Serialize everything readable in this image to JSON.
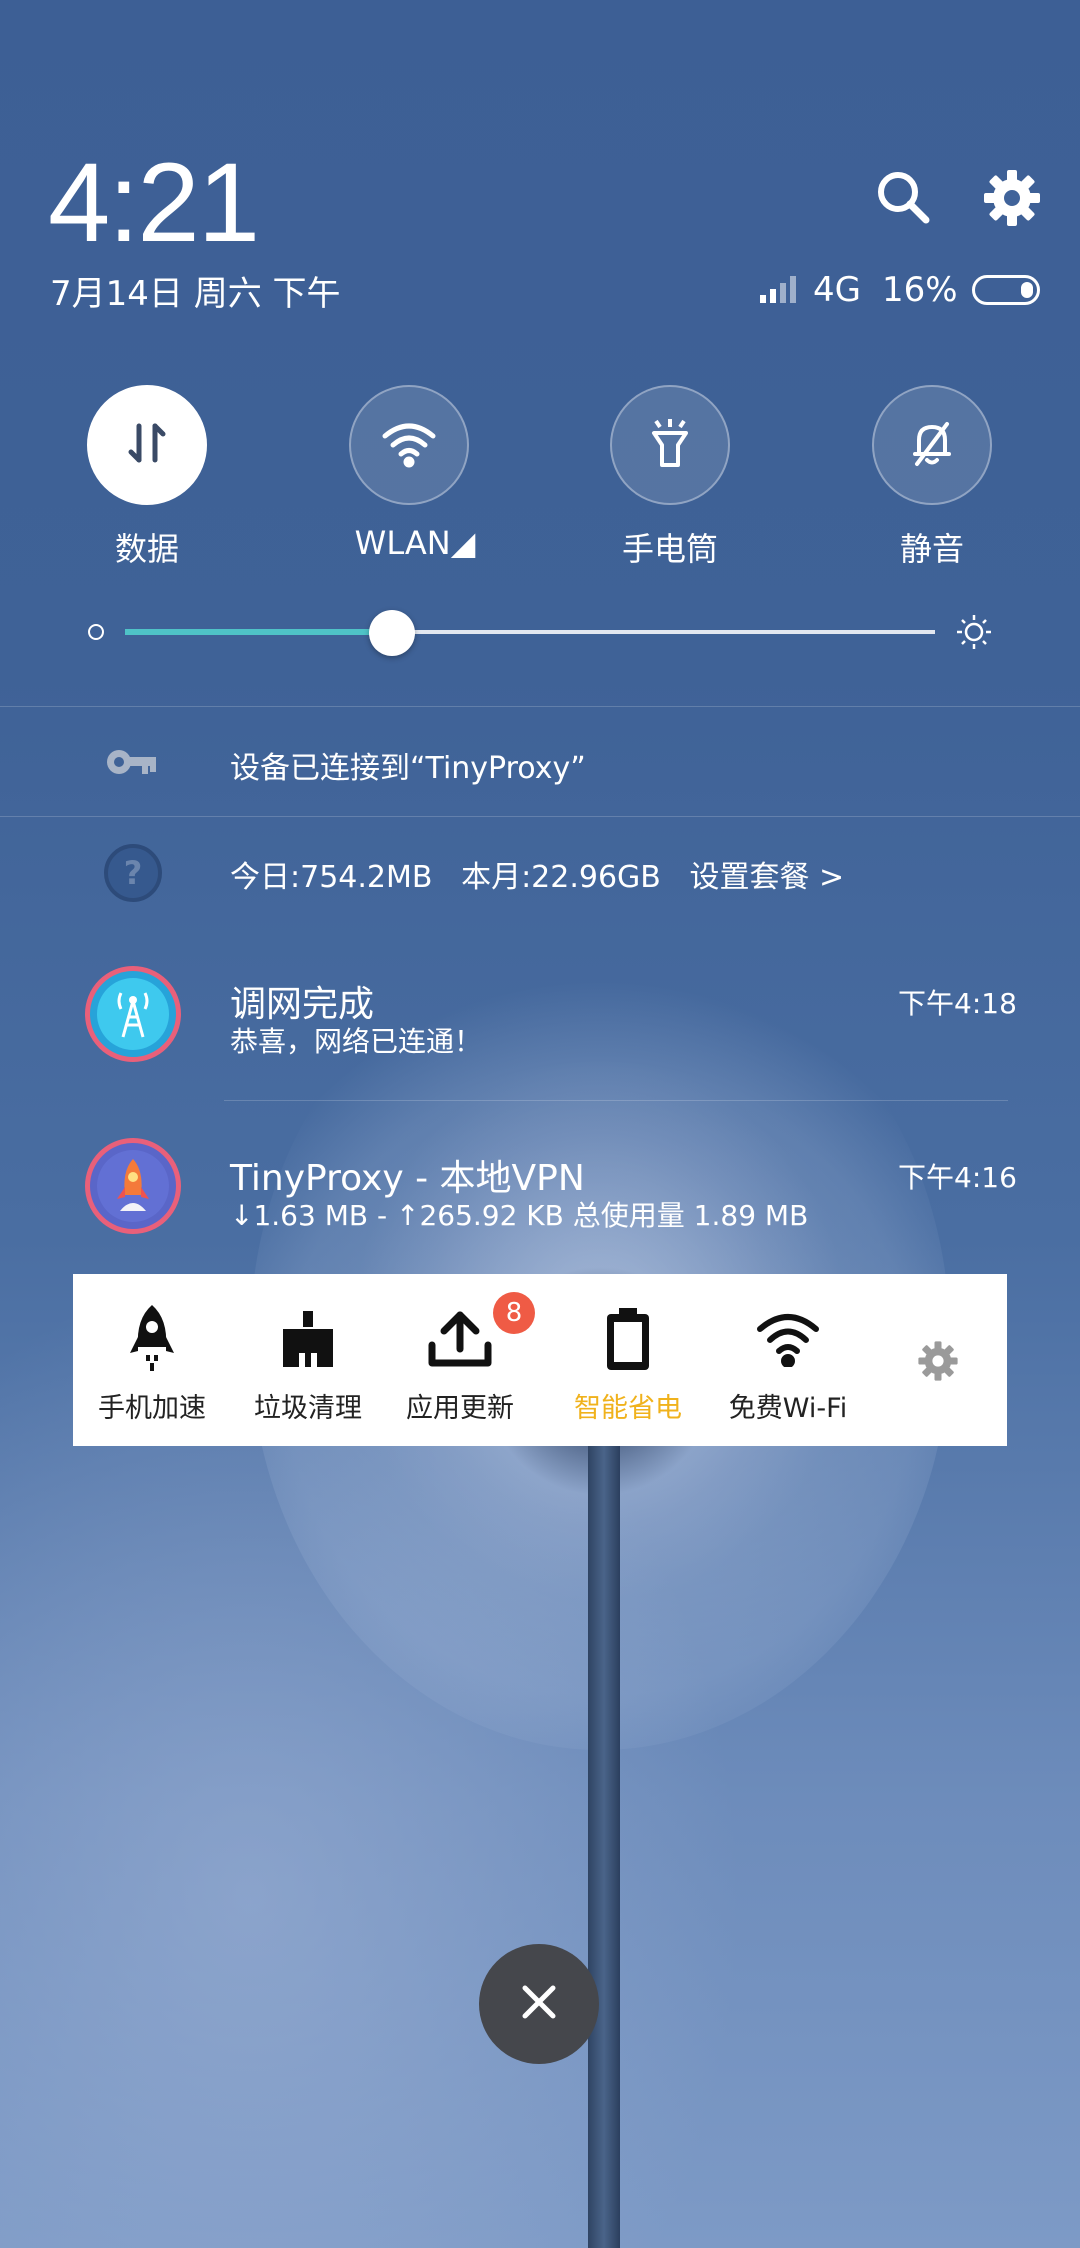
{
  "status": {
    "time": "4:21",
    "date": "7月14日 周六 下午",
    "network": "4G",
    "battery_percent": "16%"
  },
  "quick_tiles": [
    {
      "label": "数据",
      "icon": "data-transfer-icon",
      "active": true
    },
    {
      "label": "WLAN◢",
      "icon": "wifi-icon",
      "active": false
    },
    {
      "label": "手电筒",
      "icon": "flashlight-icon",
      "active": false
    },
    {
      "label": "静音",
      "icon": "mute-bell-icon",
      "active": false
    }
  ],
  "brightness": {
    "level": 0.33,
    "fill_color": "#4fc3c7"
  },
  "vpn_notice": {
    "text": "设备已连接到“TinyProxy”"
  },
  "data_usage": {
    "text": "今日:754.2MB   本月:22.96GB   设置套餐 >"
  },
  "notifications": [
    {
      "title": "调网完成",
      "subtitle": "恭喜，网络已连通！",
      "time": "下午4:18",
      "icon": "signal-tower-app-icon"
    },
    {
      "title": "TinyProxy - 本地VPN",
      "subtitle": "↓1.63 MB - ↑265.92 KB 总使用量 1.89 MB",
      "time": "下午4:16",
      "icon": "rocket-app-icon"
    }
  ],
  "toolbar": {
    "items": [
      {
        "label": "手机加速",
        "icon": "rocket-icon"
      },
      {
        "label": "垃圾清理",
        "icon": "broom-icon"
      },
      {
        "label": "应用更新",
        "icon": "upload-icon",
        "badge": "8"
      },
      {
        "label": "智能省电",
        "icon": "battery-icon"
      },
      {
        "label": "免费Wi-Fi",
        "icon": "wifi-icon"
      }
    ],
    "accent_color": "#f0b21c",
    "settings_icon": "gear-icon"
  },
  "close_button": {
    "icon": "close-icon"
  }
}
